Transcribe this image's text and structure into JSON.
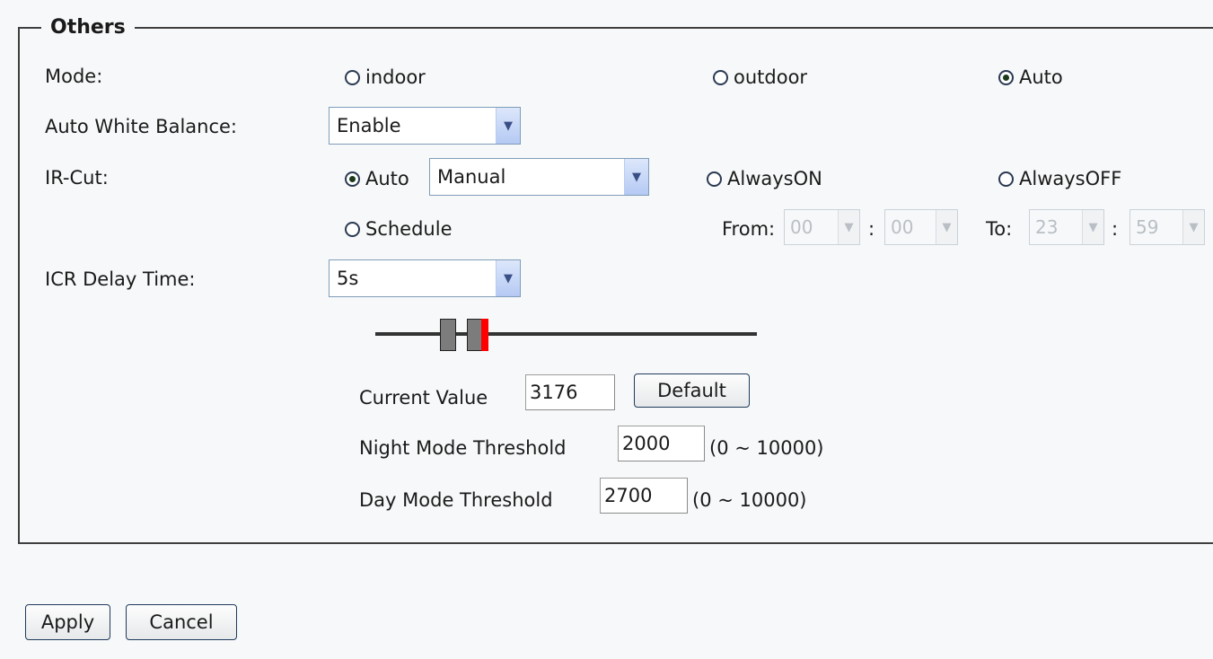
{
  "section": {
    "legend": "Others"
  },
  "mode": {
    "label": "Mode:",
    "options": [
      {
        "label": "indoor",
        "checked": false
      },
      {
        "label": "outdoor",
        "checked": false
      },
      {
        "label": "Auto",
        "checked": true
      }
    ]
  },
  "awb": {
    "label": "Auto White Balance:",
    "value": "Enable"
  },
  "ircut": {
    "label": "IR-Cut:",
    "auto_label": "Auto",
    "auto_checked": true,
    "auto_select_value": "Manual",
    "always_on_label": "AlwaysON",
    "always_off_label": "AlwaysOFF",
    "schedule_label": "Schedule",
    "from_label": "From:",
    "to_label": "To:",
    "colon": ":",
    "from_hour": "00",
    "from_minute": "00",
    "to_hour": "23",
    "to_minute": "59"
  },
  "icr_delay": {
    "label": "ICR Delay Time:",
    "value": "5s"
  },
  "slider": {
    "marker_color": "#ff0000"
  },
  "current_value": {
    "label": "Current Value",
    "value": "3176"
  },
  "default_button": "Default",
  "night_threshold": {
    "label": "Night Mode Threshold",
    "value": "2000",
    "range": "(0 ~ 10000)"
  },
  "day_threshold": {
    "label": "Day Mode Threshold",
    "value": "2700",
    "range": "(0 ~ 10000)"
  },
  "buttons": {
    "apply": "Apply",
    "cancel": "Cancel"
  }
}
